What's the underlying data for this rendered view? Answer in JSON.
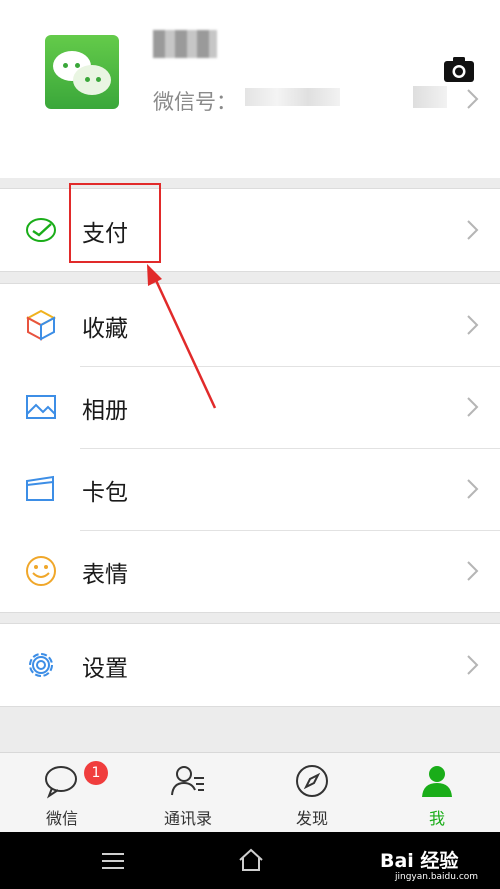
{
  "profile": {
    "wechat_id_label": "微信号：",
    "camera_icon": "camera-icon"
  },
  "menu": {
    "pay_label": "支付",
    "favorites_label": "收藏",
    "album_label": "相册",
    "cards_label": "卡包",
    "stickers_label": "表情",
    "settings_label": "设置"
  },
  "tabbar": {
    "chats_label": "微信",
    "chats_badge": "1",
    "contacts_label": "通讯录",
    "discover_label": "发现",
    "me_label": "我"
  },
  "watermark": {
    "brand": "Bai 经验",
    "url": "jingyan.baidu.com"
  },
  "colors": {
    "accent_green": "#1aad19",
    "highlight_red": "#e12a2a",
    "badge_red": "#f03d3d"
  }
}
